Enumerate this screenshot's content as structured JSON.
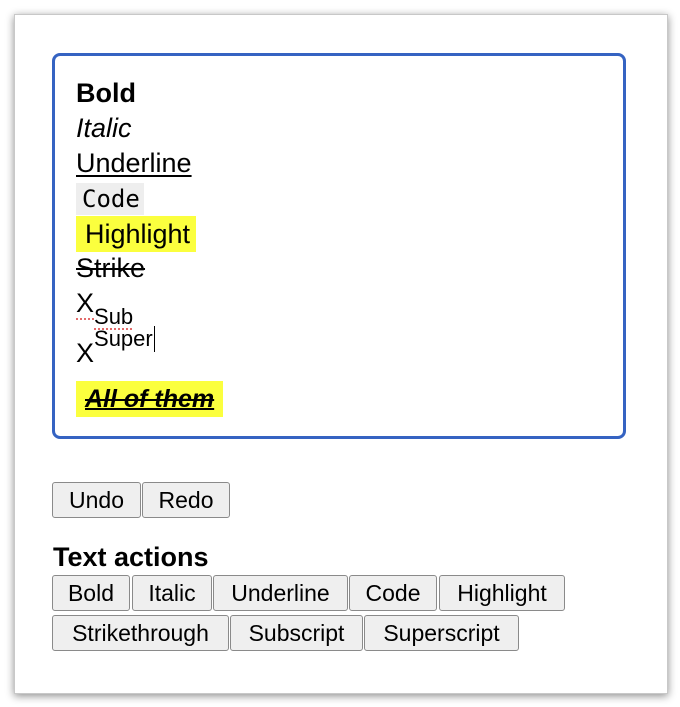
{
  "editor": {
    "lines": {
      "bold": "Bold",
      "italic": "Italic",
      "underline": "Underline",
      "code": "Code",
      "highlight": "Highlight",
      "strike": "Strike",
      "sub_base": "X",
      "sub_text": "Sub",
      "sup_base": "X",
      "sup_text": "Super",
      "all": "All of them"
    },
    "highlight_color": "#fbff3e",
    "focus_border_color": "#3563c2",
    "code_background": "#eeeeee"
  },
  "history": {
    "undo_label": "Undo",
    "redo_label": "Redo"
  },
  "text_actions": {
    "title": "Text actions",
    "buttons": {
      "bold": "Bold",
      "italic": "Italic",
      "underline": "Underline",
      "code": "Code",
      "highlight": "Highlight",
      "strikethrough": "Strikethrough",
      "subscript": "Subscript",
      "superscript": "Superscript"
    }
  }
}
